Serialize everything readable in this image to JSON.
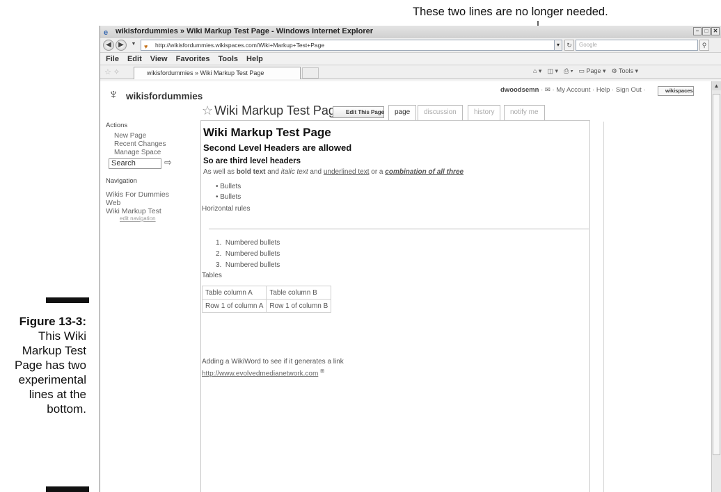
{
  "annotation": {
    "callout_text": "These two lines are no longer needed."
  },
  "figure": {
    "label": "Figure 13-3:",
    "caption": "This Wiki Markup Test Page has two experimental lines at the bottom."
  },
  "browser": {
    "window_title": "wikisfordummies » Wiki Markup Test Page - Windows Internet Explorer",
    "address": "http://wikisfordummies.wikispaces.com/Wiki+Markup+Test+Page",
    "search_placeholder": "Google",
    "menu": [
      "File",
      "Edit",
      "View",
      "Favorites",
      "Tools",
      "Help"
    ],
    "tab_title": "wikisfordummies » Wiki Markup Test Page",
    "command_bar": {
      "page": "Page",
      "tools": "Tools"
    }
  },
  "site": {
    "name": "wikisfordummies",
    "username": "dwoodsemn",
    "user_links": [
      "My Account",
      "Help",
      "Sign Out"
    ],
    "brand_button": "wikispaces"
  },
  "page": {
    "title": "Wiki Markup Test Page",
    "edit_button": "Edit This Page",
    "tabs": [
      "page",
      "discussion",
      "history",
      "notify me"
    ]
  },
  "sidebar": {
    "actions_heading": "Actions",
    "actions": [
      "New Page",
      "Recent Changes",
      "Manage Space"
    ],
    "search_value": "Search",
    "navigation_heading": "Navigation",
    "nav_links": [
      "Wikis For Dummies",
      "Web",
      "Wiki Markup Test"
    ],
    "edit_navigation": "edit navigation"
  },
  "content": {
    "h1": "Wiki Markup Test Page",
    "h2": "Second Level Headers are allowed",
    "h3": "So are third level headers",
    "para_start": "As well as",
    "bold_text": "bold text",
    "and1": "and",
    "italic_text": "italic text",
    "and2": "and",
    "underlined_text": "underlined text",
    "or_a": "or a",
    "combination": "combination of all three",
    "bullets": [
      "Bullets",
      "Bullets"
    ],
    "horizontal_rules": "Horizontal rules",
    "numbered": [
      "Numbered bullets",
      "Numbered bullets",
      "Numbered bullets"
    ],
    "tables_label": "Tables",
    "table": [
      [
        "Table column A",
        "Table column B"
      ],
      [
        "Row 1 of column A",
        "Row 1 of column B"
      ]
    ],
    "wikiword_line": "Adding a WikiWord to see if it generates a link",
    "external_link": "http://www.evolvedmedianetwork.com"
  }
}
